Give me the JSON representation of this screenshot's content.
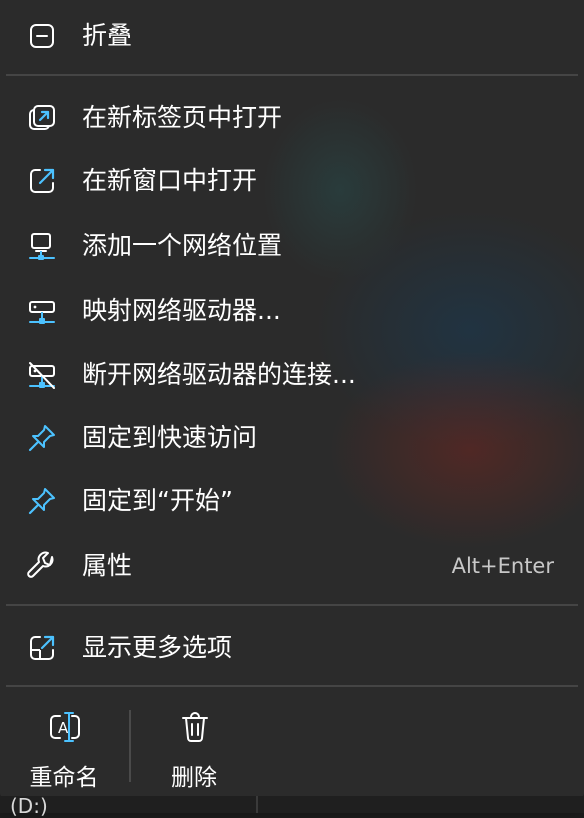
{
  "menu": {
    "items": [
      {
        "id": "collapse",
        "label": "折叠",
        "icon": "collapse-icon"
      },
      {
        "id": "open-new-tab",
        "label": "在新标签页中打开",
        "icon": "open-new-tab-icon"
      },
      {
        "id": "open-new-window",
        "label": "在新窗口中打开",
        "icon": "open-new-window-icon"
      },
      {
        "id": "add-network-location",
        "label": "添加一个网络位置",
        "icon": "network-computer-icon"
      },
      {
        "id": "map-network-drive",
        "label": "映射网络驱动器...",
        "icon": "network-drive-icon"
      },
      {
        "id": "disconnect-network-drive",
        "label": "断开网络驱动器的连接...",
        "icon": "network-drive-disconnect-icon"
      },
      {
        "id": "pin-quick-access",
        "label": "固定到快速访问",
        "icon": "pin-icon"
      },
      {
        "id": "pin-start",
        "label": "固定到“开始”",
        "icon": "pin-icon"
      },
      {
        "id": "properties",
        "label": "属性",
        "icon": "wrench-icon",
        "shortcut": "Alt+Enter"
      },
      {
        "id": "show-more-options",
        "label": "显示更多选项",
        "icon": "show-more-icon"
      }
    ],
    "bottom": [
      {
        "id": "rename",
        "label": "重命名",
        "icon": "rename-icon"
      },
      {
        "id": "delete",
        "label": "删除",
        "icon": "trash-icon"
      }
    ]
  },
  "background": {
    "drive_label": "(D:)"
  },
  "colors": {
    "menu_bg": "#2b2b2b",
    "accent": "#4cc2ff",
    "text": "#ffffff",
    "shortcut_text": "#c8c8c8",
    "separator": "#454545"
  }
}
